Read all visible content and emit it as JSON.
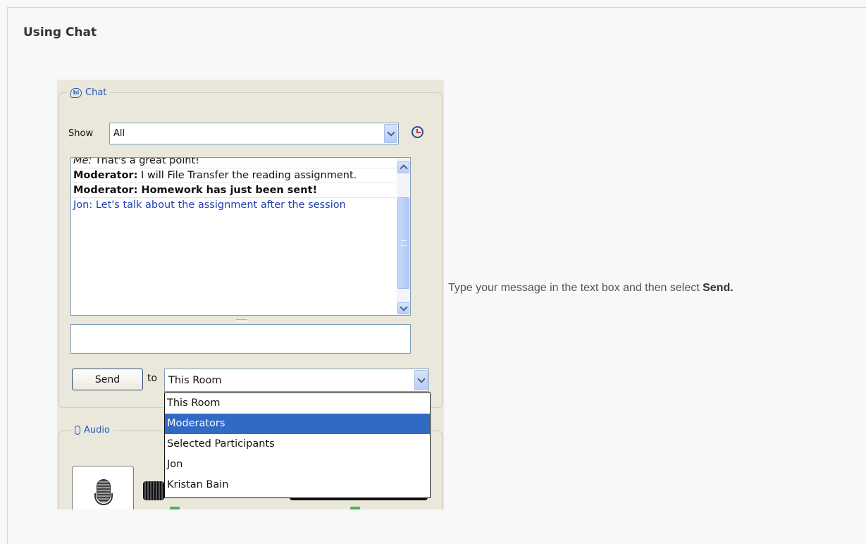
{
  "page": {
    "title": "Using Chat"
  },
  "chat_panel": {
    "legend": "Chat",
    "icon_glyph": "hi",
    "icon": "chat-bubble-icon",
    "filter_label": "Show",
    "filter_value": "All",
    "history_icon": "clock-icon",
    "messages": [
      {
        "sender": "Me:",
        "text": " That's a great point!",
        "style": "normal"
      },
      {
        "sender": "Moderator:",
        "text": " I will File Transfer the reading assignment.",
        "style": "normal"
      },
      {
        "sender": "",
        "text": "Moderator: Homework has just been sent!",
        "style": "bold"
      },
      {
        "sender": "",
        "text": "Jon: Let's talk about the assignment after the session",
        "style": "blue"
      }
    ],
    "message_input_value": "",
    "send_label": "Send",
    "to_label": "to",
    "recipient_value": "This Room",
    "recipient_options": [
      "This Room",
      "Moderators",
      "Selected Participants",
      "Jon",
      "Kristan Bain"
    ],
    "highlighted_option": "Moderators"
  },
  "audio_panel": {
    "legend": "Audio",
    "icon": "microphone-icon",
    "talk_button_icon": "microphone-icon"
  },
  "instruction": {
    "text": "Type your message in the text box and then select ",
    "emphasis": "Send."
  },
  "colors": {
    "link_blue": "#2c5bb8",
    "highlight": "#316ac5",
    "panel_bg": "#eae7db",
    "message_blue": "#1f3fb5"
  }
}
